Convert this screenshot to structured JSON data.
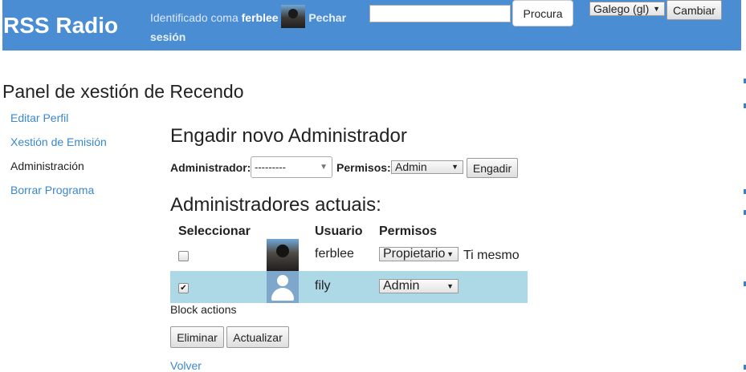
{
  "header": {
    "logo": "RSS Radio",
    "identified_as": "Identificado coma",
    "username": "ferblee",
    "logout_line1": "Pechar",
    "logout_line2": "sesión",
    "search": {
      "value": "",
      "button": "Procura"
    },
    "language": {
      "selected": "Galego (gl)",
      "button": "Cambiar"
    }
  },
  "page": {
    "title": "Panel de xestión de Recendo"
  },
  "sidebar": {
    "items": [
      {
        "label": "Editar Perfil",
        "current": false
      },
      {
        "label": "Xestión de Emisión",
        "current": false
      },
      {
        "label": "Administración",
        "current": true
      },
      {
        "label": "Borrar Programa",
        "current": false
      }
    ]
  },
  "add_admin": {
    "heading": "Engadir novo Administrador",
    "admin_label": "Administrador:",
    "admin_selected": "---------",
    "perms_label": "Permisos:",
    "perms_selected": "Admin",
    "add_button": "Engadir"
  },
  "current_admins": {
    "heading": "Administradores actuais:",
    "columns": [
      "Seleccionar",
      "",
      "Usuario",
      "Permisos"
    ],
    "rows": [
      {
        "checked": false,
        "user": "ferblee",
        "permission": "Propietario",
        "note": "Ti mesmo",
        "highlight": false
      },
      {
        "checked": true,
        "user": "fily",
        "permission": "Admin",
        "note": "",
        "highlight": true
      }
    ],
    "block_actions_label": "Block actions",
    "delete_button": "Eliminar",
    "update_button": "Actualizar",
    "back_link": "Volver"
  },
  "colors": {
    "header_bg": "#4a8dd2",
    "link": "#3a87cc",
    "row_highlight": "#add8e6"
  }
}
